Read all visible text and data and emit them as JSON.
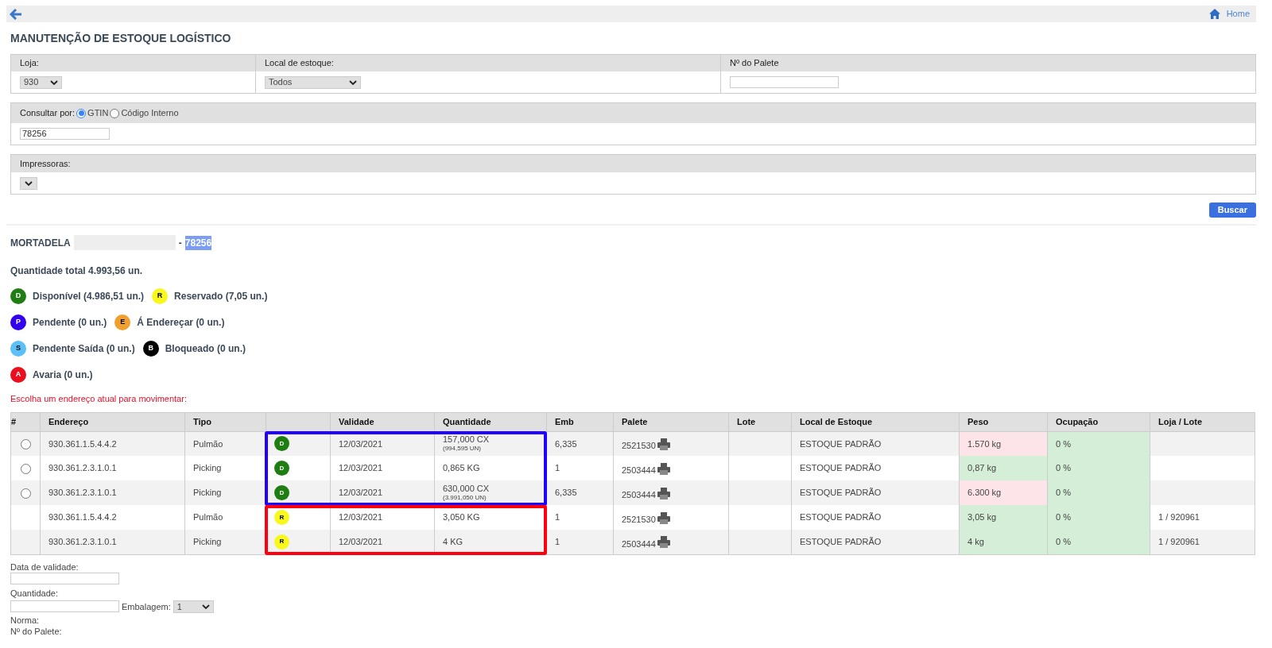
{
  "top_bar": {
    "home_link": "Home"
  },
  "title": "MANUTENÇÃO DE ESTOQUE LOGÍSTICO",
  "filters": [
    {
      "label": "Loja:",
      "kind": "select",
      "value": "930"
    },
    {
      "label": "Local de estoque:",
      "kind": "select",
      "value": "Todos"
    },
    {
      "label": "Nº do Palete",
      "kind": "text"
    }
  ],
  "search": {
    "label": "Consultar por:",
    "options": [
      {
        "label": "GTIN",
        "selected": true
      },
      {
        "label": "Código Interno",
        "selected": false
      }
    ],
    "value": "78256"
  },
  "printers": {
    "label": "Impressoras:"
  },
  "search_button": "Buscar",
  "product": {
    "name": "MORTADELA",
    "separator": "-",
    "code": "78256",
    "code_selected": true
  },
  "total": "Quantidade total 4.993,56 un.",
  "legend": [
    [
      {
        "letter": "D",
        "label": "Disponível (4.986,51 un.)",
        "color": "#1e7e12"
      },
      {
        "letter": "R",
        "label": "Reservado (7,05 un.)",
        "color": "#f8f81c"
      }
    ],
    [
      {
        "letter": "P",
        "label": "Pendente (0 un.)",
        "color": "#3300ee"
      },
      {
        "letter": "E",
        "label": "Á Endereçar (0 un.)",
        "color": "#f0a030"
      }
    ],
    [
      {
        "letter": "S",
        "label": "Pendente Saída (0 un.)",
        "color": "#5bc0f8"
      },
      {
        "letter": "B",
        "label": "Bloqueado (0 un.)",
        "color": "#000000"
      }
    ],
    [
      {
        "letter": "A",
        "label": "Avaria (0 un.)",
        "color": "#e8101e"
      }
    ]
  ],
  "instruction": "Escolha um endereço atual para movimentar:",
  "table": {
    "columns": [
      "#",
      "Endereço",
      "Tipo",
      "",
      "Validade",
      "Quantidade",
      "Emb",
      "Palete",
      "Lote",
      "Local de Estoque",
      "Peso",
      "Ocupação",
      "Loja / Lote"
    ],
    "rows": [
      {
        "selectable": true,
        "selected": false,
        "address": "930.361.1.5.4.4.2",
        "type": "Pulmão",
        "status": {
          "letter": "D",
          "color": "#1e7e12"
        },
        "validity": "12/03/2021",
        "quantity": "157,000 CX",
        "quantity_detail": "(994,595 UN)",
        "emb": "6,335",
        "pallet": "2521530",
        "location": "ESTOQUE PADRÃO",
        "weight": "1.570 kg",
        "weight_alert": true,
        "occupancy": "0 %",
        "color": "#2200ff"
      },
      {
        "selectable": true,
        "selected": false,
        "address": "930.361.2.3.1.0.1",
        "type": "Picking",
        "status": {
          "letter": "D",
          "color": "#1e7e12"
        },
        "validity": "12/03/2021",
        "quantity": "0,865 KG",
        "emb": "1",
        "pallet": "2503444",
        "location": "ESTOQUE PADRÃO",
        "weight": "0,87 kg",
        "weight_alert": false,
        "occupancy": "0 %",
        "color": "#2200ff"
      },
      {
        "selectable": true,
        "selected": false,
        "address": "930.361.2.3.1.0.1",
        "type": "Picking",
        "status": {
          "letter": "D",
          "color": "#1e7e12"
        },
        "validity": "12/03/2021",
        "quantity": "630,000 CX",
        "quantity_detail": "(3.991,050 UN)",
        "emb": "6,335",
        "pallet": "2503444",
        "location": "ESTOQUE PADRÃO",
        "weight": "6.300 kg",
        "weight_alert": true,
        "occupancy": "0 %",
        "color": "#2200ff"
      },
      {
        "selectable": false,
        "address": "930.361.1.5.4.4.2",
        "type": "Pulmão",
        "status": {
          "letter": "R",
          "color": "#f8f81c"
        },
        "validity": "12/03/2021",
        "quantity": "3,050 KG",
        "emb": "1",
        "pallet": "2521530",
        "location": "ESTOQUE PADRÃO",
        "weight": "3,05 kg",
        "weight_alert": false,
        "occupancy": "0 %",
        "store_lot": "1 / 920961",
        "color": "#ff0010"
      },
      {
        "selectable": false,
        "address": "930.361.2.3.1.0.1",
        "type": "Picking",
        "status": {
          "letter": "R",
          "color": "#f8f81c"
        },
        "validity": "12/03/2021",
        "quantity": "4 KG",
        "emb": "1",
        "pallet": "2503444",
        "location": "ESTOQUE PADRÃO",
        "weight": "4 kg",
        "weight_alert": false,
        "occupancy": "0 %",
        "store_lot": "1 / 920961",
        "color": "#ff0010"
      }
    ]
  },
  "form": [
    {
      "label": "Data de validade:",
      "kind": "text"
    },
    {
      "label": "Quantidade:",
      "kind": "text_with_select",
      "select_label": "Embalagem:",
      "select_value": "1"
    },
    {
      "label": "Norma:",
      "kind": "label"
    },
    {
      "label": "Nº do Palete:",
      "kind": "label"
    }
  ]
}
